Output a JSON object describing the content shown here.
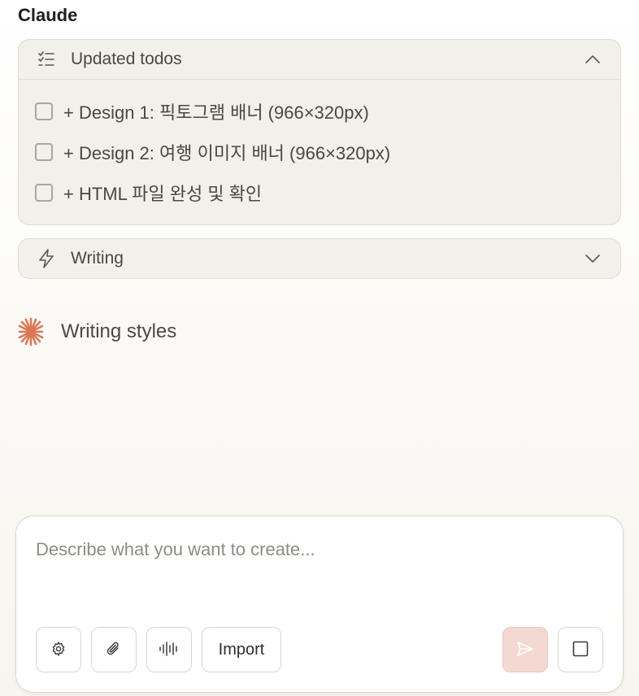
{
  "message": {
    "sender": "Claude",
    "todos_card": {
      "title": "Updated todos",
      "items": [
        {
          "label": "+ Design 1: 픽토그램 배너 (966×320px)",
          "checked": false
        },
        {
          "label": "+ Design 2: 여행 이미지 배너 (966×320px)",
          "checked": false
        },
        {
          "label": "+ HTML 파일 완성 및 확인",
          "checked": false
        }
      ]
    },
    "writing_card": {
      "title": "Writing"
    },
    "status_text": "Writing styles"
  },
  "composer": {
    "placeholder": "Describe what you want to create...",
    "import_label": "Import"
  },
  "colors": {
    "accent": "#d97757",
    "send_bg": "#f4d9d2"
  },
  "icons": [
    "checklist-icon",
    "chevron-up-icon",
    "lightning-icon",
    "chevron-down-icon",
    "claude-star-icon",
    "gear-icon",
    "paperclip-icon",
    "audio-waveform-icon",
    "send-icon",
    "stop-square-icon"
  ]
}
